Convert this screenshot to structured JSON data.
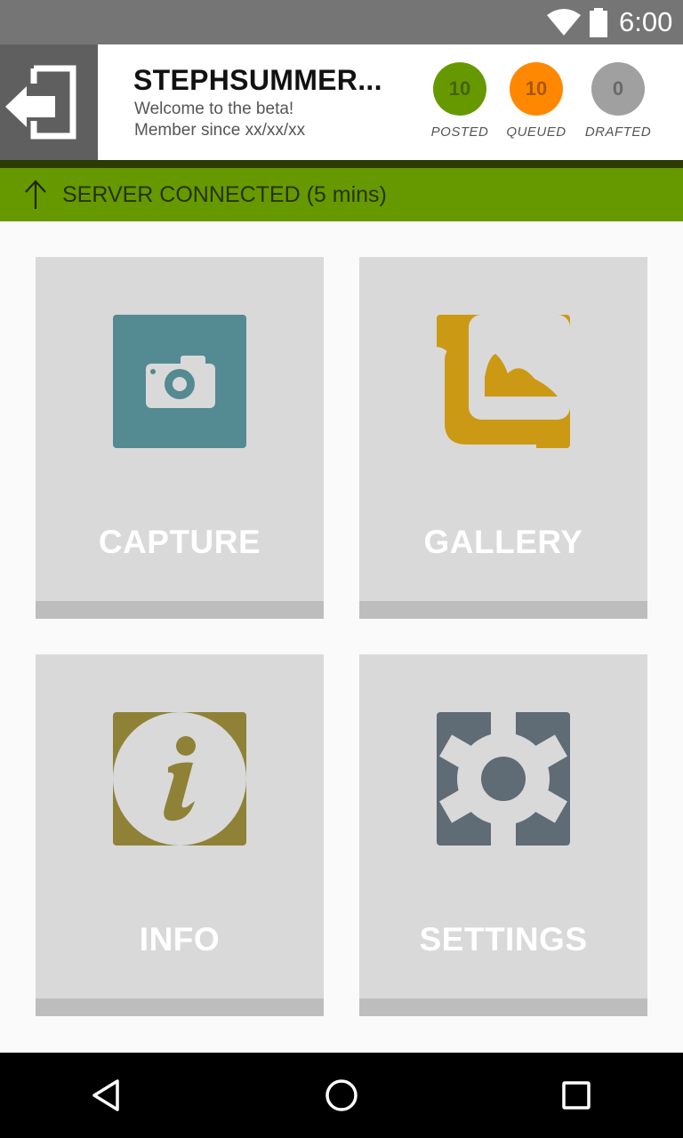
{
  "status_bar": {
    "time": "6:00",
    "icons": [
      "wifi-icon",
      "battery-icon"
    ]
  },
  "header": {
    "logout_icon": "logout-icon",
    "user_name": "STEPHSUMMER...",
    "welcome": "Welcome to the beta!",
    "member_since": "Member since xx/xx/xx",
    "counters": [
      {
        "value": "10",
        "label": "POSTED",
        "color": "#669900"
      },
      {
        "value": "10",
        "label": "QUEUED",
        "color": "#ff8800"
      },
      {
        "value": "0",
        "label": "DRAFTED",
        "color": "#a0a0a0"
      }
    ]
  },
  "server": {
    "icon": "upload-arrow-icon",
    "text": "SERVER CONNECTED (5 mins)",
    "color": "#669900"
  },
  "tiles": [
    {
      "label": "CAPTURE",
      "icon": "camera-icon",
      "color": "#548a92"
    },
    {
      "label": "GALLERY",
      "icon": "gallery-icon",
      "color": "#cc9914"
    },
    {
      "label": "INFO",
      "icon": "info-icon",
      "color": "#8f8136"
    },
    {
      "label": "SETTINGS",
      "icon": "gear-icon",
      "color": "#5f6b75"
    }
  ],
  "nav_bar": {
    "buttons": [
      "back-icon",
      "home-icon",
      "recents-icon"
    ]
  }
}
